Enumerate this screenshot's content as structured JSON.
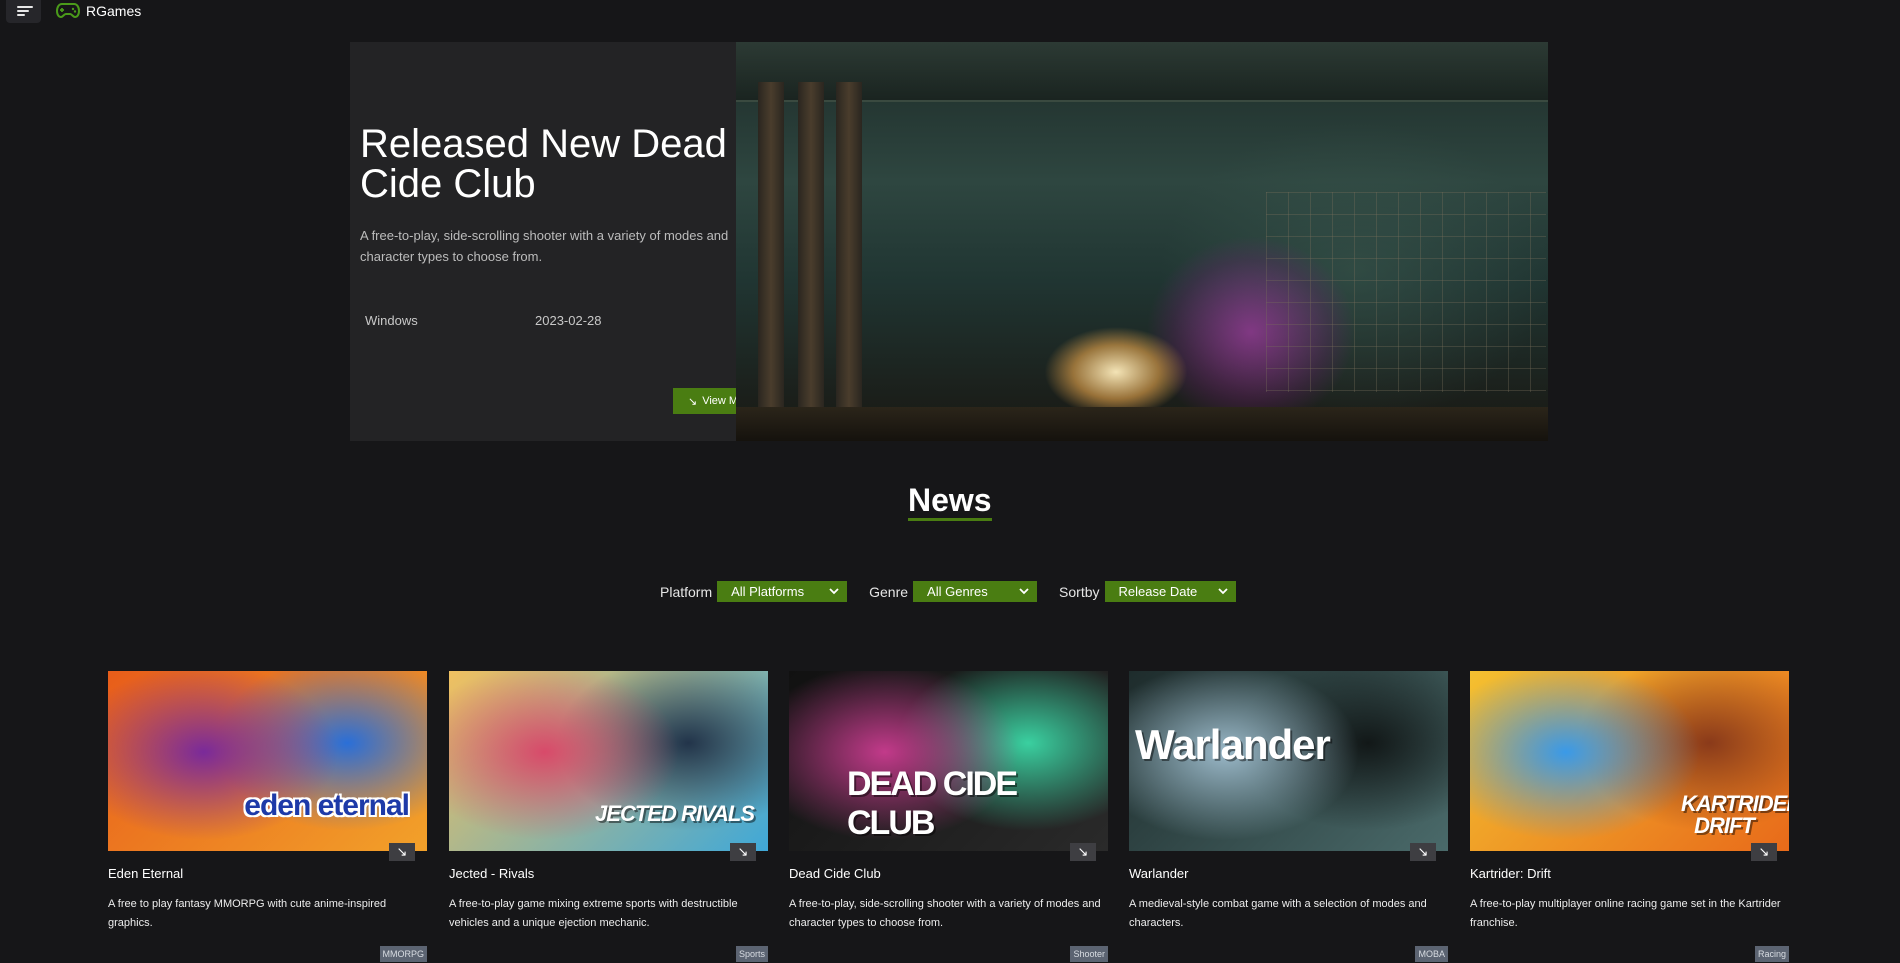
{
  "app": {
    "brand": "RGames",
    "accent": "#4a7d12"
  },
  "hero": {
    "title": "Released New Dead Cide Club",
    "description": "A free-to-play, side-scrolling shooter with a variety of modes and character types to choose from.",
    "platform": "Windows",
    "release_date": "2023-02-28",
    "button_label": "View More",
    "button_icon": "arrow-down-right-icon"
  },
  "news": {
    "title": "News",
    "filters": {
      "platform_label": "Platform",
      "platform_value": "All Platforms",
      "genre_label": "Genre",
      "genre_value": "All Genres",
      "sort_label": "Sortby",
      "sort_value": "Release Date"
    },
    "cards": [
      {
        "title": "Eden Eternal",
        "description": "A free to play fantasy MMORPG with cute anime-inspired graphics.",
        "genre": "MMORPG",
        "logo_text": "eden eternal",
        "colors": [
          "#e85d1a",
          "#f2a12a",
          "#7a2a9a",
          "#2a6fd8"
        ]
      },
      {
        "title": "Jected - Rivals",
        "description": "A free-to-play game mixing extreme sports with destructible vehicles and a unique ejection mechanic.",
        "genre": "Sports",
        "logo_text": "JECTED RIVALS",
        "colors": [
          "#f0c060",
          "#3fa8d8",
          "#d84a6a",
          "#22344a"
        ]
      },
      {
        "title": "Dead Cide Club",
        "description": "A free-to-play, side-scrolling shooter with a variety of modes and character types to choose from.",
        "genre": "Shooter",
        "logo_text": "DEAD CIDE CLUB",
        "colors": [
          "#111111",
          "#2a2a2a",
          "#c23a8a",
          "#3ad0a0"
        ]
      },
      {
        "title": "Warlander",
        "description": "A medieval-style combat game with a selection of modes and characters.",
        "genre": "MOBA",
        "logo_text": "Warlander",
        "colors": [
          "#1e2c2c",
          "#4a6a6a",
          "#9ab8c8",
          "#121818"
        ]
      },
      {
        "title": "Kartrider: Drift",
        "description": "A free-to-play multiplayer online racing game set in the Kartrider franchise.",
        "genre": "Racing",
        "logo_text": "KARTRIDER DRIFT",
        "colors": [
          "#f4c030",
          "#e86a1a",
          "#3a9ae8",
          "#8a3a1a"
        ]
      }
    ]
  }
}
